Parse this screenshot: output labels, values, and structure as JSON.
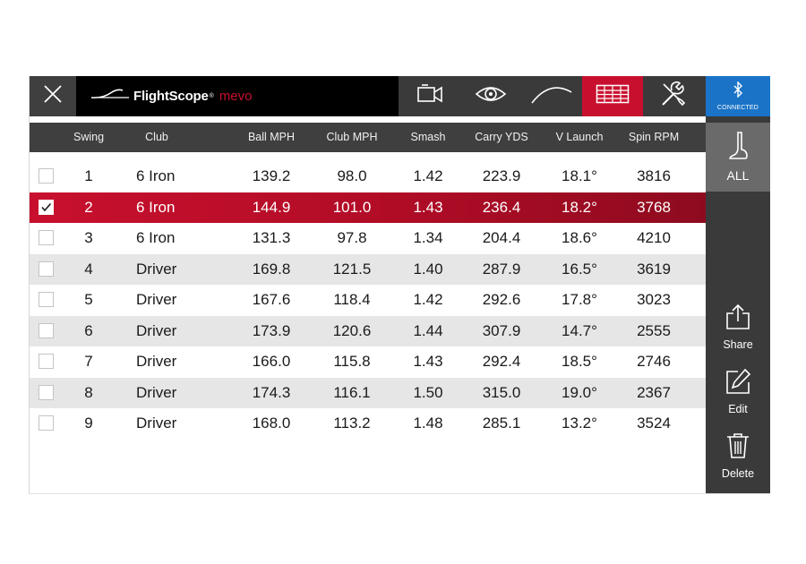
{
  "brand": {
    "name": "FlightScope",
    "reg": "®",
    "product": "mevo"
  },
  "connection": {
    "status": "CONNECTED"
  },
  "sidebar": {
    "all_label": "ALL",
    "share_label": "Share",
    "edit_label": "Edit",
    "delete_label": "Delete"
  },
  "colors": {
    "accent": "#c8102e",
    "bar": "#3a3a3a",
    "connected": "#1a73c7",
    "stripe": "#e6e6e6"
  },
  "icons": {
    "close": "close-icon",
    "video": "video-camera-icon",
    "view": "eye-icon",
    "trajectory": "trajectory-icon",
    "table": "table-icon",
    "settings": "tools-icon",
    "bluetooth": "bluetooth-icon",
    "club": "golf-club-icon",
    "share": "share-icon",
    "edit": "edit-icon",
    "delete": "trash-icon"
  },
  "table": {
    "headers": [
      "Swing",
      "Club",
      "Ball MPH",
      "Club MPH",
      "Smash",
      "Carry YDS",
      "V Launch",
      "Spin RPM"
    ],
    "rows": [
      {
        "checked": false,
        "cells": [
          "1",
          "6 Iron",
          "139.2",
          "98.0",
          "1.42",
          "223.9",
          "18.1°",
          "3816"
        ]
      },
      {
        "checked": true,
        "cells": [
          "2",
          "6 Iron",
          "144.9",
          "101.0",
          "1.43",
          "236.4",
          "18.2°",
          "3768"
        ]
      },
      {
        "checked": false,
        "cells": [
          "3",
          "6 Iron",
          "131.3",
          "97.8",
          "1.34",
          "204.4",
          "18.6°",
          "4210"
        ]
      },
      {
        "checked": false,
        "cells": [
          "4",
          "Driver",
          "169.8",
          "121.5",
          "1.40",
          "287.9",
          "16.5°",
          "3619"
        ]
      },
      {
        "checked": false,
        "cells": [
          "5",
          "Driver",
          "167.6",
          "118.4",
          "1.42",
          "292.6",
          "17.8°",
          "3023"
        ]
      },
      {
        "checked": false,
        "cells": [
          "6",
          "Driver",
          "173.9",
          "120.6",
          "1.44",
          "307.9",
          "14.7°",
          "2555"
        ]
      },
      {
        "checked": false,
        "cells": [
          "7",
          "Driver",
          "166.0",
          "115.8",
          "1.43",
          "292.4",
          "18.5°",
          "2746"
        ]
      },
      {
        "checked": false,
        "cells": [
          "8",
          "Driver",
          "174.3",
          "116.1",
          "1.50",
          "315.0",
          "19.0°",
          "2367"
        ]
      },
      {
        "checked": false,
        "cells": [
          "9",
          "Driver",
          "168.0",
          "113.2",
          "1.48",
          "285.1",
          "13.2°",
          "3524"
        ]
      }
    ]
  }
}
